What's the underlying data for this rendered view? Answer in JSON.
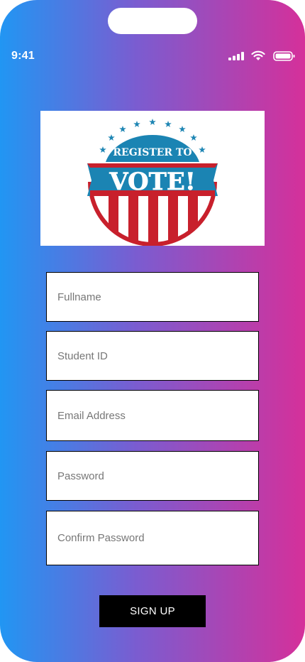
{
  "status_bar": {
    "time": "9:41",
    "icons": [
      "cellular-signal-icon",
      "wifi-icon",
      "battery-icon"
    ]
  },
  "banner": {
    "line1": "REGISTER TO",
    "line2": "VOTE!",
    "colors": {
      "blue": "#1b84b3",
      "red": "#c8202c",
      "star": "#1f86b4"
    }
  },
  "form": {
    "fields": [
      {
        "name": "fullname-input",
        "placeholder": "Fullname",
        "type": "text",
        "value": ""
      },
      {
        "name": "student-id-input",
        "placeholder": "Student ID",
        "type": "text",
        "value": ""
      },
      {
        "name": "email-input",
        "placeholder": "Email Address",
        "type": "email",
        "value": ""
      },
      {
        "name": "password-input",
        "placeholder": "Password",
        "type": "password",
        "value": ""
      },
      {
        "name": "confirm-password-input",
        "placeholder": "Confirm Password",
        "type": "password",
        "value": ""
      }
    ],
    "submit_label": "SIGN UP"
  },
  "theme": {
    "gradient_start": "#2196f3",
    "gradient_mid": "#7b5cd0",
    "gradient_end": "#d5309a",
    "button_bg": "#000000",
    "button_text": "#ffffff"
  }
}
